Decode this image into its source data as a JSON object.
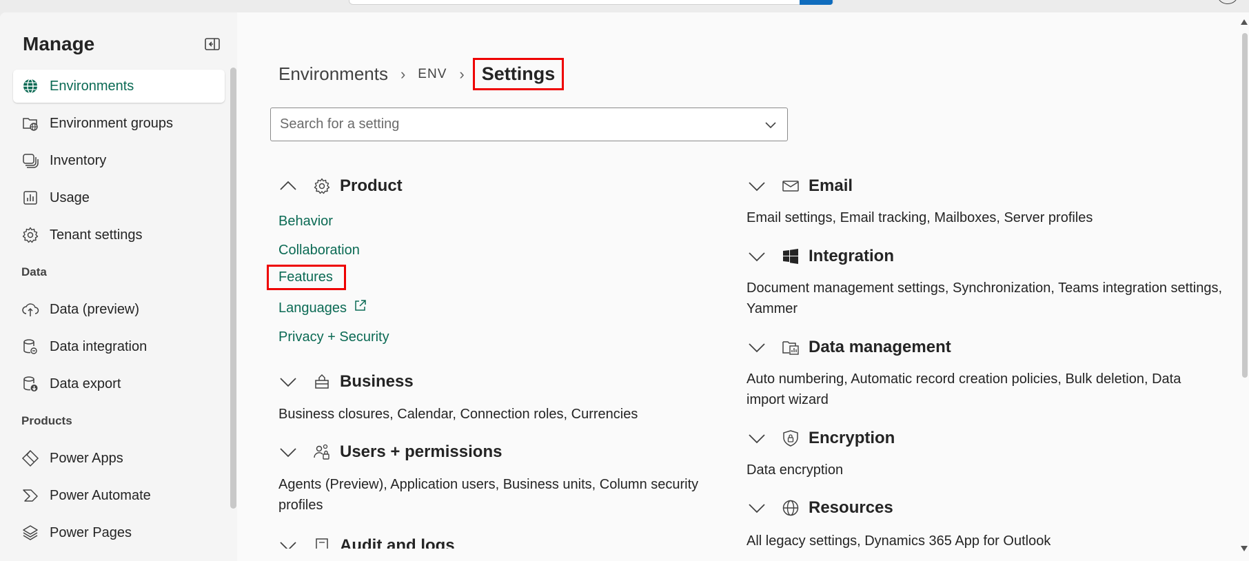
{
  "sidebar": {
    "title": "Manage",
    "items": [
      {
        "label": "Environments",
        "icon": "globe-icon",
        "active": true
      },
      {
        "label": "Environment groups",
        "icon": "folder-globe-icon"
      },
      {
        "label": "Inventory",
        "icon": "stack-icon"
      },
      {
        "label": "Usage",
        "icon": "chart-icon"
      },
      {
        "label": "Tenant settings",
        "icon": "gear-icon"
      }
    ],
    "section_data": "Data",
    "data_items": [
      {
        "label": "Data (preview)",
        "icon": "cloud-upload-icon"
      },
      {
        "label": "Data integration",
        "icon": "database-link-icon"
      },
      {
        "label": "Data export",
        "icon": "database-export-icon"
      }
    ],
    "section_products": "Products",
    "product_items": [
      {
        "label": "Power Apps",
        "icon": "power-apps-icon"
      },
      {
        "label": "Power Automate",
        "icon": "power-automate-icon"
      },
      {
        "label": "Power Pages",
        "icon": "power-pages-icon"
      }
    ]
  },
  "breadcrumb": {
    "root": "Environments",
    "env": "ENV",
    "current": "Settings"
  },
  "search": {
    "placeholder": "Search for a setting"
  },
  "left_sections": {
    "product": {
      "title": "Product",
      "links": [
        "Behavior",
        "Collaboration",
        "Features",
        "Languages",
        "Privacy + Security"
      ]
    },
    "business": {
      "title": "Business",
      "desc": "Business closures, Calendar, Connection roles, Currencies"
    },
    "users": {
      "title": "Users + permissions",
      "desc": "Agents (Preview), Application users, Business units, Column security profiles"
    },
    "audit": {
      "title": "Audit and logs"
    }
  },
  "right_sections": {
    "email": {
      "title": "Email",
      "desc": "Email settings, Email tracking, Mailboxes, Server profiles"
    },
    "integration": {
      "title": "Integration",
      "desc": "Document management settings, Synchronization, Teams integration settings, Yammer"
    },
    "data_management": {
      "title": "Data management",
      "desc": "Auto numbering, Automatic record creation policies, Bulk deletion, Data import wizard"
    },
    "encryption": {
      "title": "Encryption",
      "desc": "Data encryption"
    },
    "resources": {
      "title": "Resources",
      "desc": "All legacy settings, Dynamics 365 App for Outlook"
    }
  },
  "colors": {
    "link": "#0b6a54",
    "highlight": "#ee0000",
    "active_bg": "#ffffff"
  }
}
